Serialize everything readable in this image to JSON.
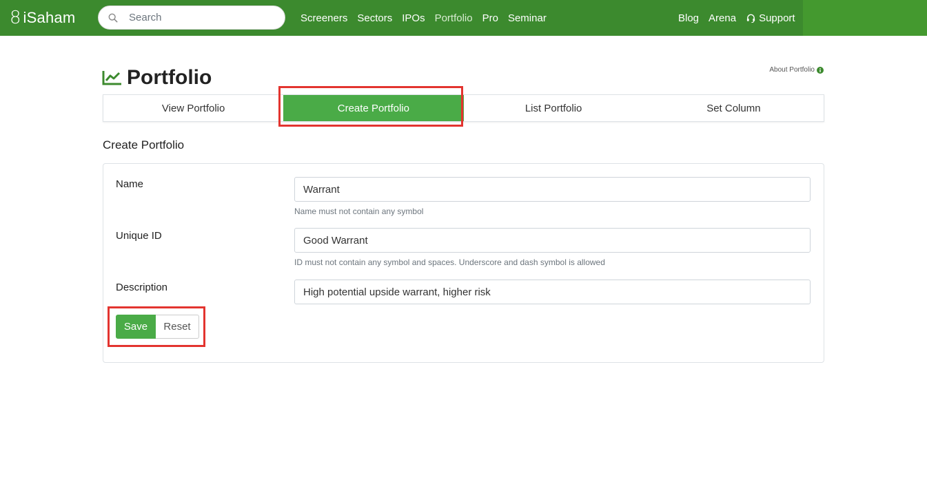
{
  "navbar": {
    "brand": "iSaham",
    "brand_icon": "8",
    "search_placeholder": "Search",
    "links": [
      "Screeners",
      "Sectors",
      "IPOs",
      "Portfolio",
      "Pro",
      "Seminar"
    ],
    "right_links": [
      "Blog",
      "Arena",
      "Support"
    ],
    "color": "#3c8a2e"
  },
  "page": {
    "title": "Portfolio",
    "about": "About Portfolio"
  },
  "tabs": [
    "View Portfolio",
    "Create Portfolio",
    "List Portfolio",
    "Set Column"
  ],
  "active_tab": "Create Portfolio",
  "form": {
    "section_title": "Create Portfolio",
    "name_label": "Name",
    "name_value": "Warrant",
    "name_help": "Name must not contain any symbol",
    "uid_label": "Unique ID",
    "uid_value": "Good Warrant",
    "uid_help": "ID must not contain any symbol and spaces. Underscore and dash symbol is allowed",
    "desc_label": "Description",
    "desc_value": "High potential upside warrant, higher risk",
    "save_label": "Save",
    "reset_label": "Reset"
  },
  "colors": {
    "accent": "#4aab47",
    "highlight": "#e3342f"
  }
}
